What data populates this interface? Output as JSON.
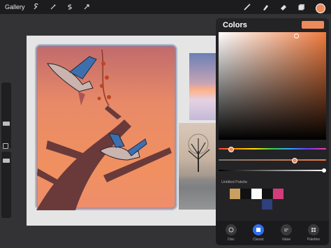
{
  "toolbar": {
    "gallery_label": "Gallery",
    "left_icons": [
      "wrench-icon",
      "magic-wand-icon",
      "selection-icon",
      "transform-arrow-icon"
    ],
    "right_icons": [
      "brush-icon",
      "smudge-icon",
      "eraser-icon",
      "layers-icon"
    ],
    "current_color": "#ee8a5a"
  },
  "colors_panel": {
    "title": "Colors",
    "current_color": "#ee8a5a",
    "palette_label": "Untitled Palette",
    "palette": [
      "#c9a060",
      "#111111",
      "#ffffff",
      "#111111",
      "#d43b7a",
      "#2e3f7c"
    ],
    "tabs": [
      {
        "label": "Disc",
        "icon": "disc-icon",
        "active": false
      },
      {
        "label": "Classic",
        "icon": "classic-icon",
        "active": true
      },
      {
        "label": "Value",
        "icon": "value-icon",
        "active": false
      },
      {
        "label": "Palettes",
        "icon": "palettes-icon",
        "active": false
      }
    ]
  },
  "colors": {
    "accent": "#2f6ff2",
    "panel_bg": "#232325",
    "toolbar_bg": "#1c1c1e"
  }
}
